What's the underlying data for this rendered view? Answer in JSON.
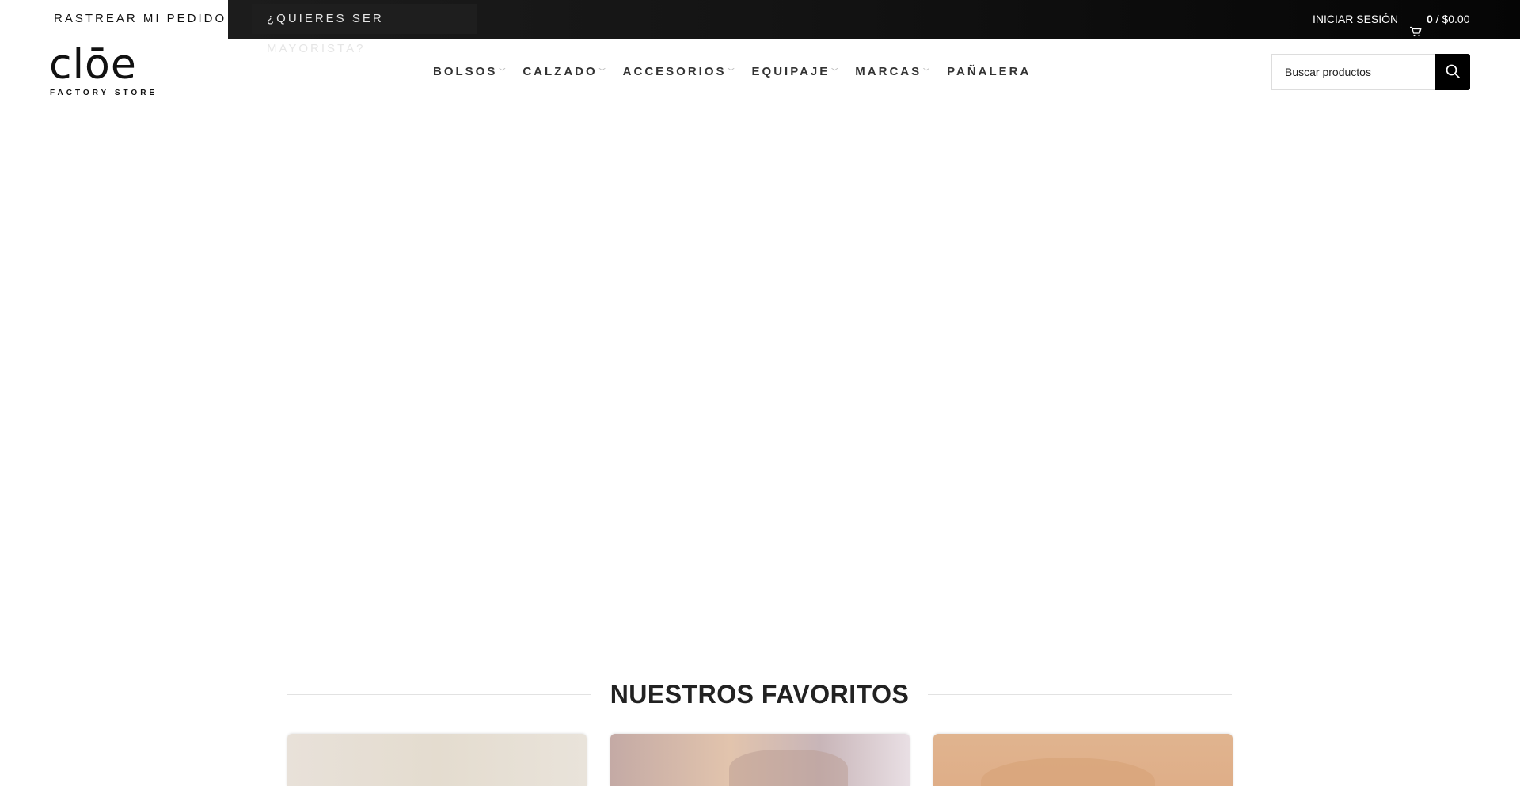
{
  "topbar": {
    "track_order": "RASTREAR MI PEDIDO",
    "wholesale": "¿QUIERES SER MAYORISTA?",
    "login": "INICIAR SESIÓN",
    "cart_count": "0",
    "cart_sep": " / ",
    "cart_total": "$0.00"
  },
  "logo": {
    "word": "clōe",
    "subtitle": "FACTORY STORE"
  },
  "nav": {
    "items": [
      {
        "label": "BOLSOS",
        "has_dropdown": true
      },
      {
        "label": "CALZADO",
        "has_dropdown": true
      },
      {
        "label": "ACCESORIOS",
        "has_dropdown": true
      },
      {
        "label": "EQUIPAJE",
        "has_dropdown": true
      },
      {
        "label": "MARCAS",
        "has_dropdown": true
      },
      {
        "label": "PAÑALERA",
        "has_dropdown": false
      }
    ]
  },
  "search": {
    "placeholder": "Buscar productos",
    "icon": "search-icon"
  },
  "favorites": {
    "title": "NUESTROS FAVORITOS"
  },
  "colors": {
    "topbar_dark": "#0b0b0b",
    "accent": "#000000"
  }
}
